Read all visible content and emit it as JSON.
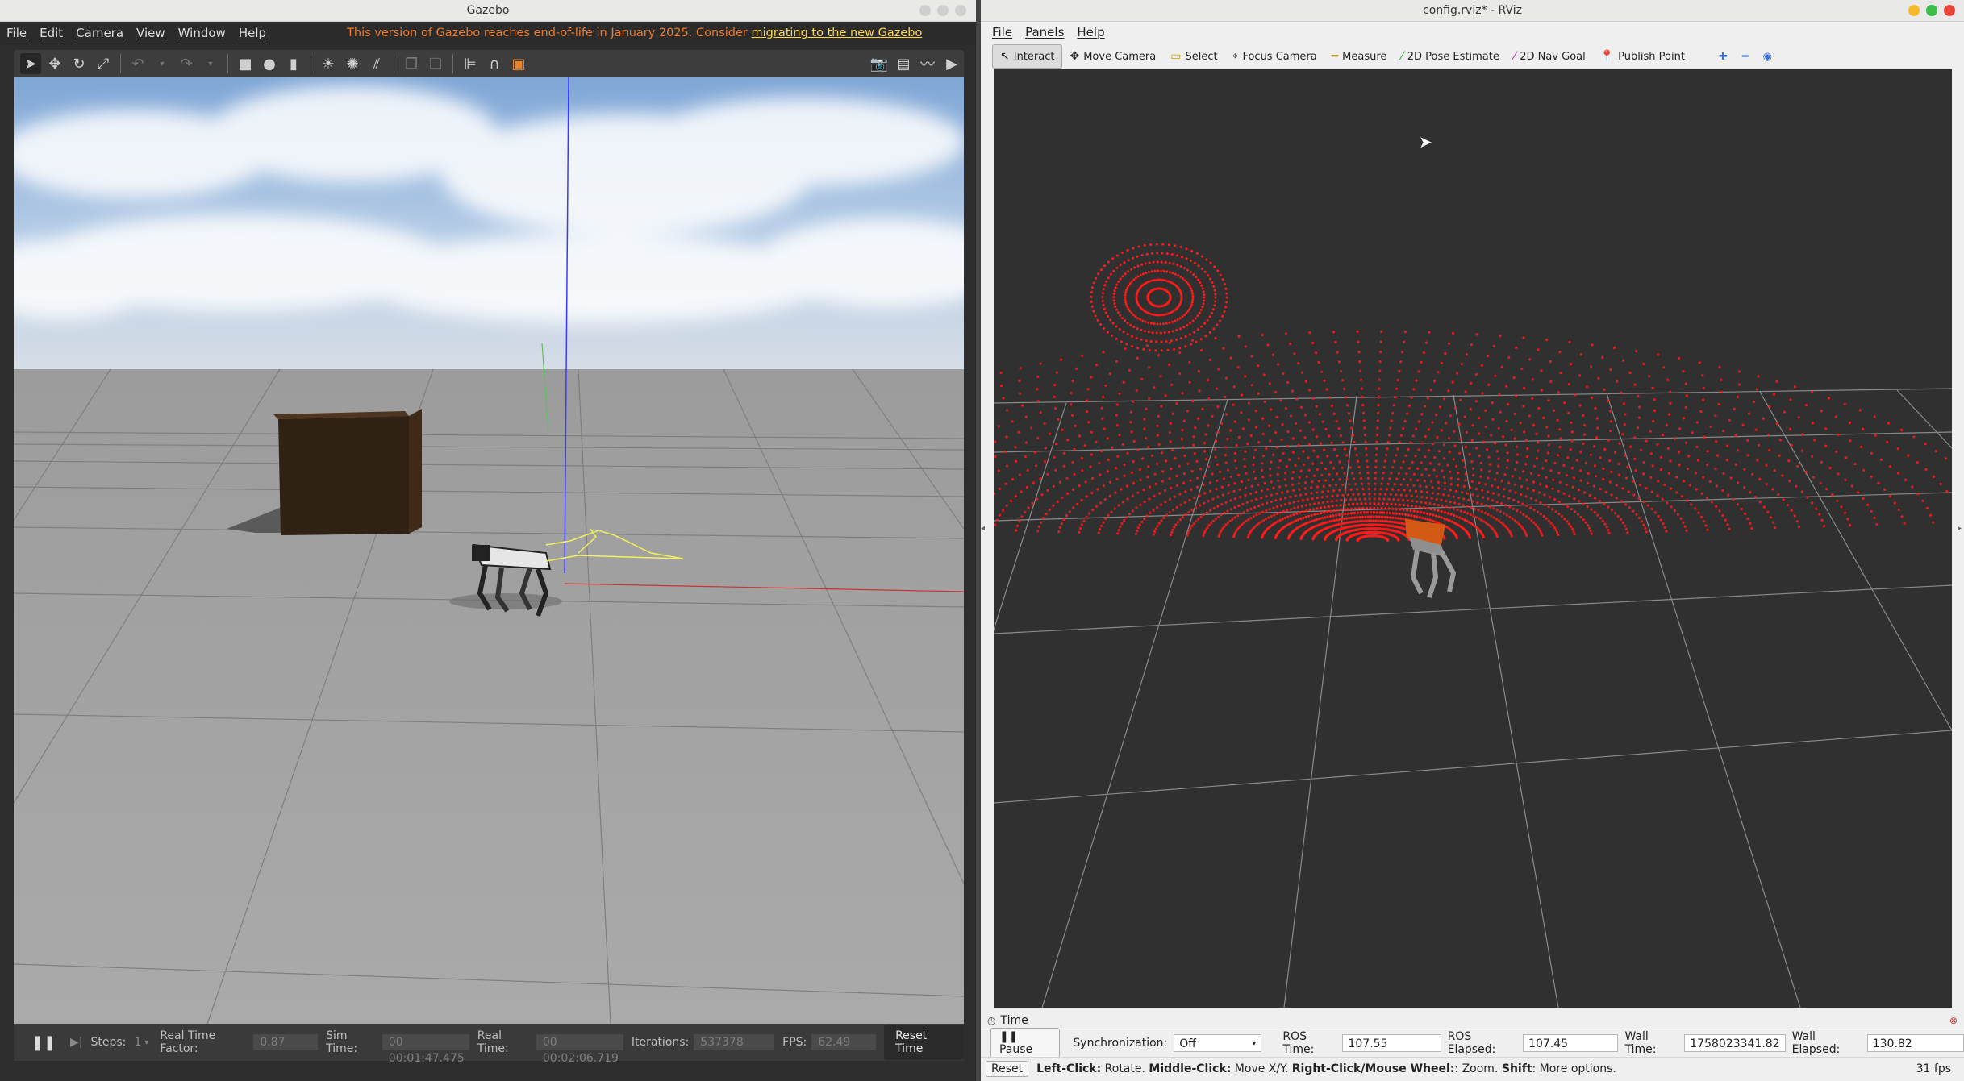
{
  "gazebo": {
    "title": "Gazebo",
    "menu": [
      "File",
      "Edit",
      "Camera",
      "View",
      "Window",
      "Help"
    ],
    "eol_notice": "This version of Gazebo reaches end-of-life in January 2025. Consider",
    "eol_link": "migrating to the new Gazebo",
    "bottom": {
      "steps_label": "Steps:",
      "steps_value": "1",
      "rtf_label": "Real Time Factor:",
      "rtf_value": "0.87",
      "sim_time_label": "Sim Time:",
      "sim_time_value": "00 00:01:47.475",
      "real_time_label": "Real Time:",
      "real_time_value": "00 00:02:06.719",
      "iterations_label": "Iterations:",
      "iterations_value": "537378",
      "fps_label": "FPS:",
      "fps_value": "62.49",
      "reset_time": "Reset Time"
    }
  },
  "rviz": {
    "title": "config.rviz* - RViz",
    "menu": [
      "File",
      "Panels",
      "Help"
    ],
    "tools": [
      "Interact",
      "Move Camera",
      "Select",
      "Focus Camera",
      "Measure",
      "2D Pose Estimate",
      "2D Nav Goal",
      "Publish Point"
    ],
    "time_panel": {
      "title": "Time",
      "pause": "Pause",
      "sync_label": "Synchronization:",
      "sync_value": "Off",
      "ros_time_label": "ROS Time:",
      "ros_time_value": "107.55",
      "ros_elapsed_label": "ROS Elapsed:",
      "ros_elapsed_value": "107.45",
      "wall_time_label": "Wall Time:",
      "wall_time_value": "1758023341.82",
      "wall_elapsed_label": "Wall Elapsed:",
      "wall_elapsed_value": "130.82"
    },
    "status": {
      "reset": "Reset",
      "b1": "Left-Click:",
      "t1": " Rotate. ",
      "b2": "Middle-Click:",
      "t2": " Move X/Y. ",
      "b3": "Right-Click/Mouse Wheel:",
      "t3": ": Zoom. ",
      "b4": "Shift",
      "t4": ": More options.",
      "fps": "31 fps"
    }
  },
  "colors": {
    "gazebo_eol_text": "#f07a2a",
    "gazebo_eol_link": "#ffd84a",
    "rviz_background": "#303030",
    "pointcloud": "#ff1a1a"
  }
}
